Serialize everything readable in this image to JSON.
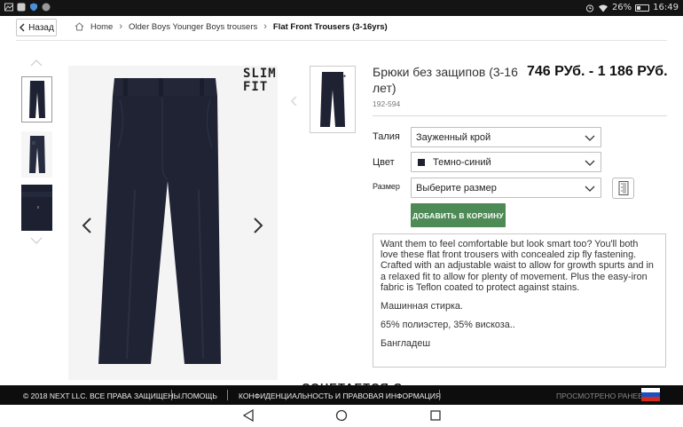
{
  "status_bar": {
    "battery": "26%",
    "time": "16:49"
  },
  "breadcrumb": {
    "back_label": "Назад",
    "home": "Home",
    "category": "Older Boys Younger Boys trousers",
    "current": "Flat Front Trousers (3-16yrs)"
  },
  "badge": {
    "line1": "SLIM",
    "line2": "FIT"
  },
  "product": {
    "title": "Брюки без защипов (3-16 лет)",
    "price": "746 РУб. - 1 186 РУб.",
    "sku": "192-594"
  },
  "options": {
    "waist_label": "Талия",
    "waist_value": "Зауженный крой",
    "color_label": "Цвет",
    "color_value": "Темно-синий",
    "color_swatch": "#1d2130",
    "size_label": "Размер",
    "size_value": "Выберите размер"
  },
  "add_to_cart": "ДОБАВИТЬ В КОРЗИНУ",
  "description": {
    "text": "Want them to feel comfortable but look smart too? You'll both love these flat front trousers with concealed zip fly fastening. Crafted with an adjustable waist to allow for growth spurts and in a relaxed fit to allow for plenty of movement. Plus the easy-iron fabric is Teflon coated to protect against stains.",
    "care": "Машинная стирка.",
    "composition": "65% полиэстер, 35% вискоза..",
    "origin": "Бангладеш"
  },
  "peek_heading": "СОЧЕТАЕТСЯ С",
  "footer": {
    "copyright": "© 2018 NEXT LLC. ВСЕ ПРАВА ЗАЩИЩЕНЫ.",
    "help": "ПОМОЩЬ",
    "privacy": "КОНФИДЕНЦИАЛЬНОСТЬ И ПРАВОВАЯ ИНФОРМАЦИЯ",
    "recently_viewed": "ПРОСМОТРЕНО РАНЕЕ"
  },
  "colors": {
    "accent": "#4e8a56",
    "trousers": "#1e2233",
    "footer_bg": "#0d0d0d"
  },
  "icons": [
    "chevron-left-icon",
    "home-icon",
    "chevron-right-icon",
    "chevron-down-icon",
    "ruler-icon",
    "back-icon",
    "home-circle-icon",
    "recents-icon",
    "russia-flag-icon"
  ]
}
